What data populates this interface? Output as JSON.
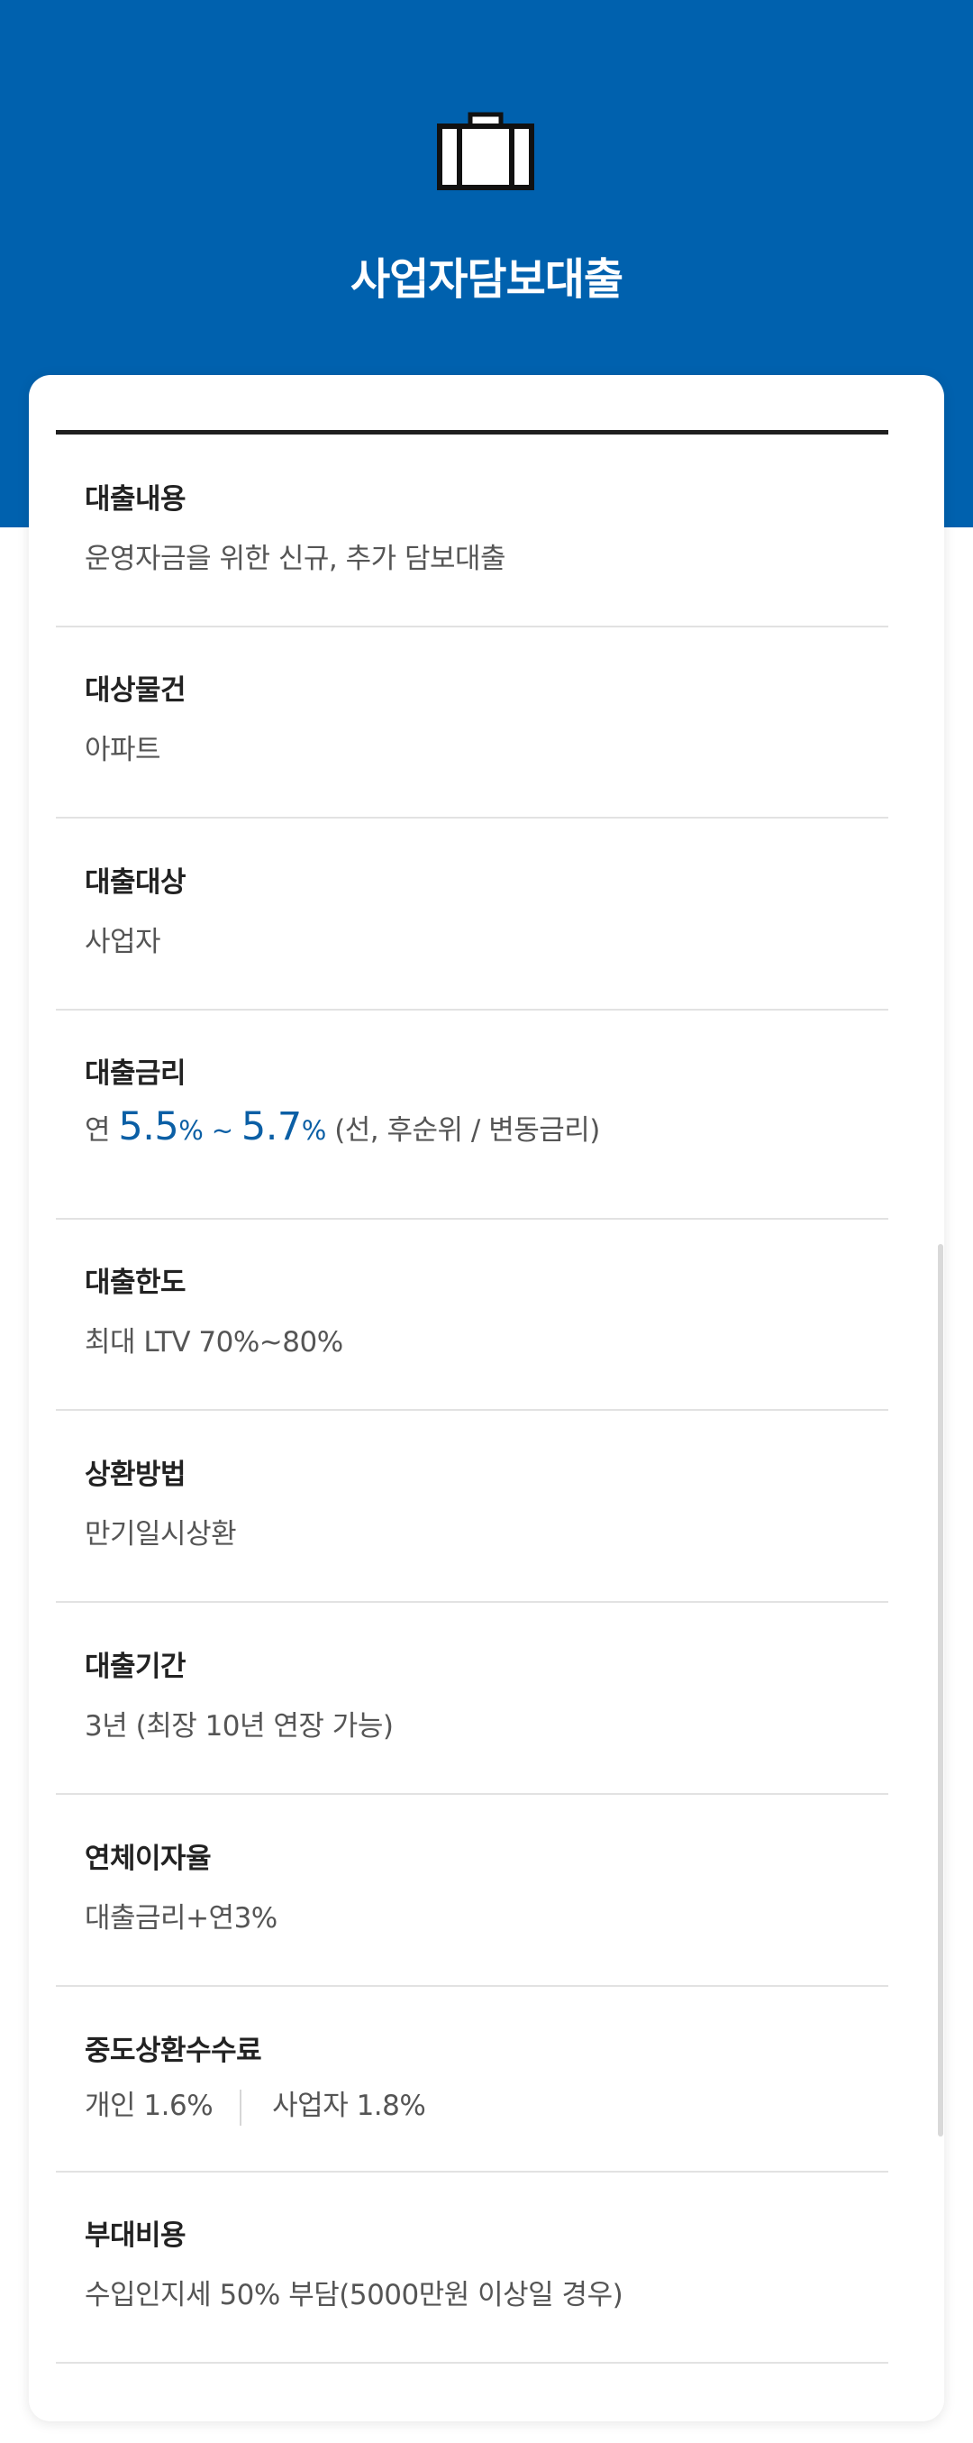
{
  "header": {
    "title": "사업자담보대출",
    "icon": "briefcase-icon",
    "background_color": "#0061ae"
  },
  "details": [
    {
      "label": "대출내용",
      "value": "운영자금을 위한 신규, 추가 담보대출"
    },
    {
      "label": "대상물건",
      "value": "아파트"
    },
    {
      "label": "대출대상",
      "value": "사업자"
    },
    {
      "label": "대출금리",
      "rate": {
        "prefix": "연",
        "min": "5.5",
        "tilde": "~",
        "max": "5.7",
        "unit": "%",
        "suffix": "(선, 후순위 / 변동금리)",
        "accent_color": "#0b5fa5"
      }
    },
    {
      "label": "대출한도",
      "value": "최대 LTV 70%~80%"
    },
    {
      "label": "상환방법",
      "value": "만기일시상환"
    },
    {
      "label": "대출기간",
      "value": "3년 (최장 10년 연장 가능)"
    },
    {
      "label": "연체이자율",
      "value": "대출금리+연3%"
    },
    {
      "label": "중도상환수수료",
      "split": [
        "개인 1.6%",
        "사업자 1.8%"
      ]
    },
    {
      "label": "부대비용",
      "value": "수입인지세 50% 부담(5000만원 이상일 경우)"
    }
  ]
}
